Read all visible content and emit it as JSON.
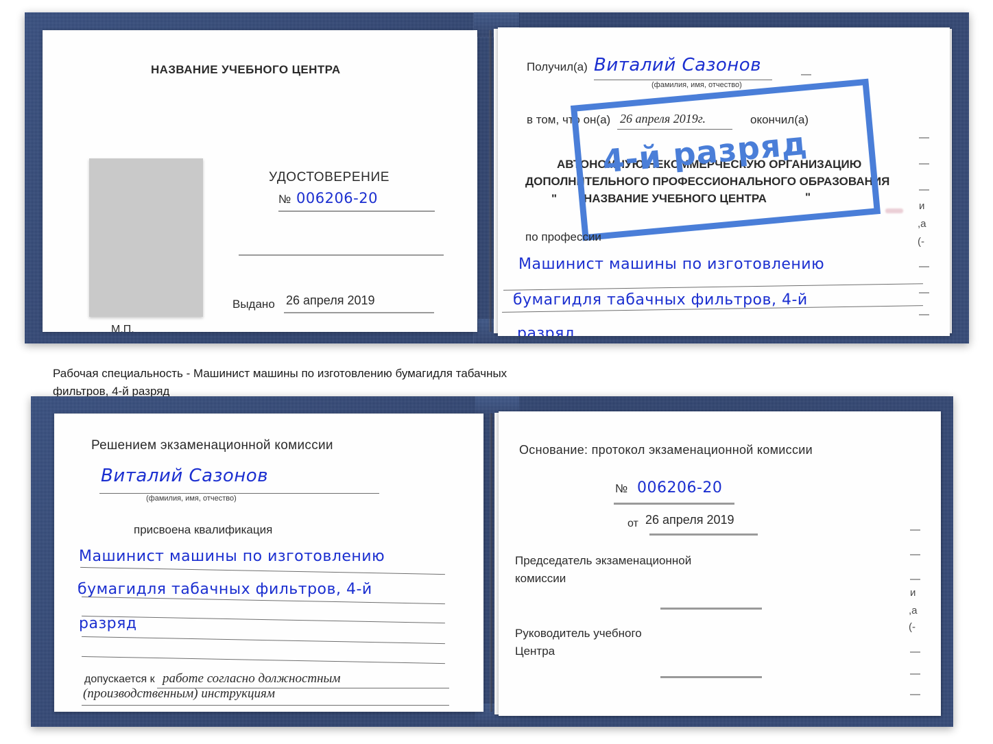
{
  "document": {
    "kind": "Удостоверение (рабочая специальность)",
    "number": "006206-20",
    "issue_date": "26 апреля 2019",
    "issue_date_long": "26 апреля 2019г.",
    "holder": "Виталий Сазонов",
    "qualification_lines": [
      "Машинист машины по изготовлению",
      "бумагидля табачных фильтров, 4-й",
      "разряд"
    ],
    "rank_stamp": "4-й разряд"
  },
  "caption": {
    "line1": "Рабочая специальность - Машинист машины по изготовлению бумагидля табачных",
    "line2": "фильтров, 4-й разряд"
  },
  "book1": {
    "left_page": {
      "center_name": "НАЗВАНИЕ УЧЕБНОГО ЦЕНТРА",
      "title": "УДОСТОВЕРЕНИЕ",
      "number_prefix": "№",
      "number_value": "006206-20",
      "issued_label": "Выдано",
      "issued_value": "26 апреля 2019",
      "seal_label": "М.П."
    },
    "right_page": {
      "received_label": "Получил(а)",
      "received_value": "Виталий Сазонов",
      "fio_hint": "(фамилия, имя, отчество)",
      "in_that_label": "в том, что он(а)",
      "in_that_date": "26 апреля 2019г.",
      "finished_label": "окончил(а)",
      "org_line1": "АВТОНОМНУЮ НЕКОММЕРЧЕСКУЮ ОРГАНИЗАЦИЮ",
      "org_line2": "ДОПОЛНИТЕЛЬНОГО ПРОФЕССИОНАЛЬНОГО ОБРАЗОВАНИЯ",
      "org_quote_open": "\"",
      "org_line3": "НАЗВАНИЕ УЧЕБНОГО ЦЕНТРА",
      "org_quote_close": "\"",
      "profession_label": "по профессии",
      "profession_line1": "Машинист машины по изготовлению",
      "profession_line2": "бумагидля табачных фильтров, 4-й",
      "profession_line3": "разряд",
      "stamp_text": "4-й разряд",
      "margin_fragments": [
        "—",
        "—",
        "—",
        "и",
        "а",
        "(-",
        "—",
        "—",
        "—",
        "—"
      ]
    }
  },
  "book2": {
    "left_page": {
      "heading": "Решением экзаменационной комиссии",
      "name_value": "Виталий Сазонов",
      "fio_hint": "(фамилия, имя, отчество)",
      "assigned_label": "присвоена квалификация",
      "qual_line1": "Машинист машины по изготовлению",
      "qual_line2": "бумагидля табачных фильтров, 4-й",
      "qual_line3": "разряд",
      "admitted_label": "допускается к",
      "admitted_value1": "работе согласно должностным",
      "admitted_value2": "(производственным) инструкциям"
    },
    "right_page": {
      "basis_label": "Основание: протокол экзаменационной комиссии",
      "number_prefix": "№",
      "number_value": "006206-20",
      "date_prefix": "от",
      "date_value": "26 апреля 2019",
      "chair_line1": "Председатель экзаменационной",
      "chair_line2": "комиссии",
      "head_line1": "Руководитель учебного",
      "head_line2": "Центра",
      "margin_fragments": [
        "—",
        "—",
        "—",
        "и",
        "а",
        "(-",
        "—",
        "—",
        "—",
        "—"
      ]
    }
  },
  "colors": {
    "cover_blue": "#1d3468",
    "ink_blue": "#1b2fd0",
    "stamp_blue": "#4a7ed8",
    "photo_gray": "#c9c9c9",
    "rule_gray": "#9a9a9a"
  }
}
